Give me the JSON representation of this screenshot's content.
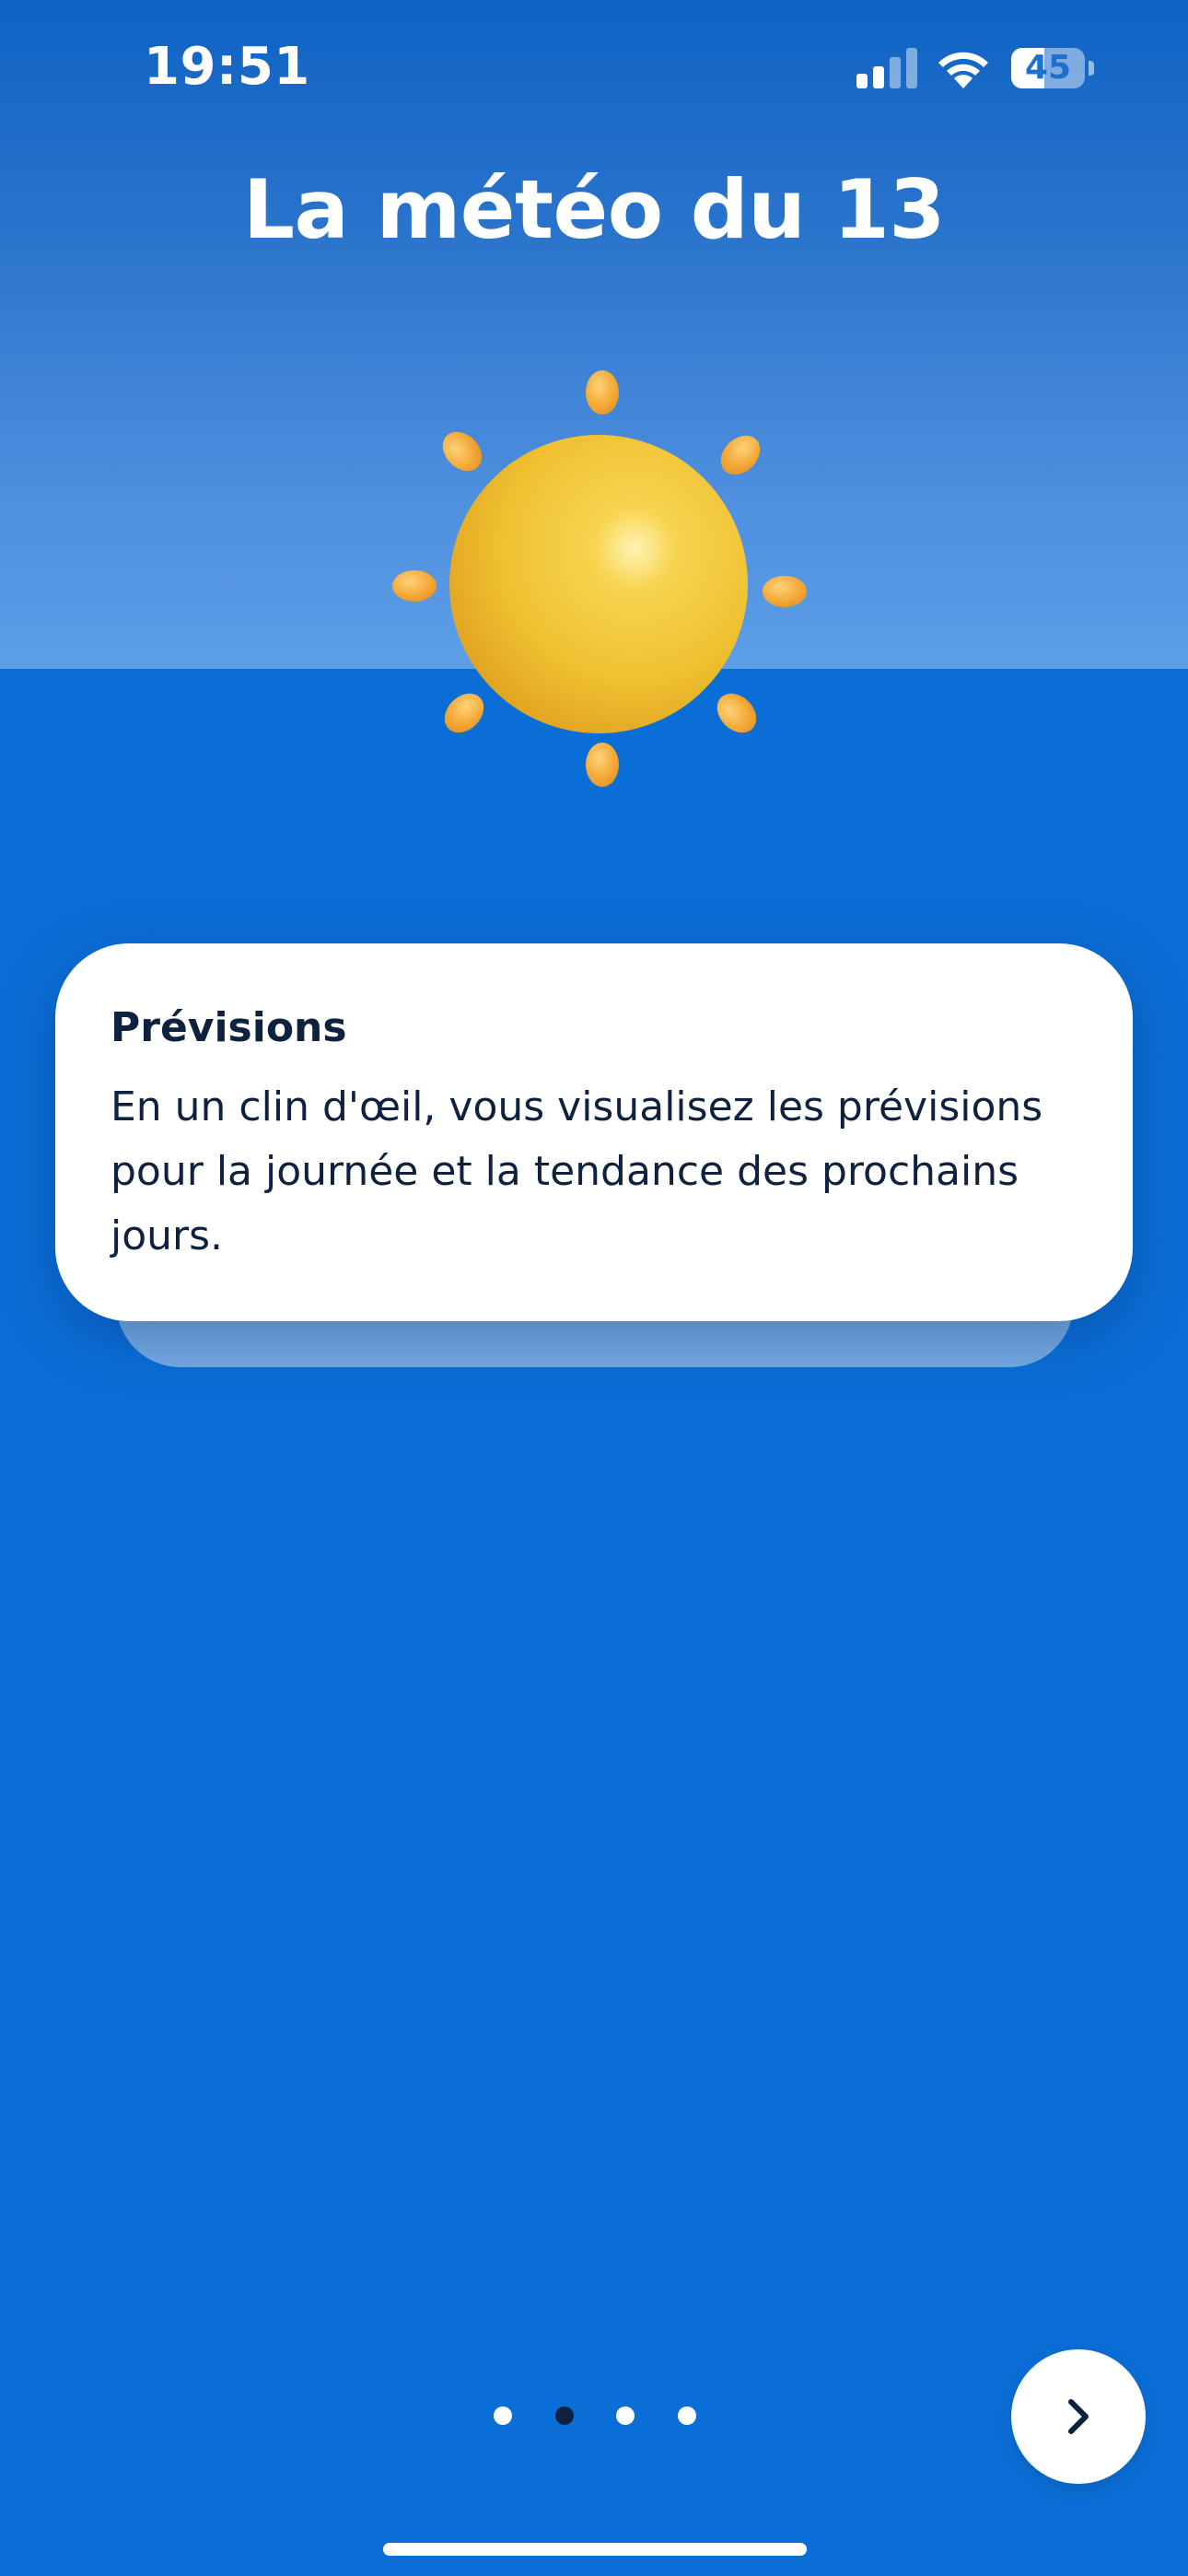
{
  "status_bar": {
    "time": "19:51",
    "battery_level": "45",
    "battery_fraction": 0.45,
    "icons": [
      "signal-icon",
      "wifi-icon",
      "battery-icon"
    ]
  },
  "header": {
    "title": "La météo du 13"
  },
  "illustration": {
    "icon": "sun-icon"
  },
  "card": {
    "title": "Prévisions",
    "body": "En un clin d'œil, vous visualisez les prévisions pour la journée et la tendance des prochains jours."
  },
  "pagination": {
    "total_pages": 4,
    "current_page": 2
  },
  "navigation": {
    "next_icon": "chevron-right-icon"
  },
  "colors": {
    "background": "#0b6ed6",
    "gradient_top": "#0f63c4",
    "gradient_bottom": "#5d9ee8",
    "card": "#ffffff",
    "text_dark": "#0e2240",
    "sun_yellow": "#f2c232",
    "ray_orange": "#f2a93a"
  }
}
